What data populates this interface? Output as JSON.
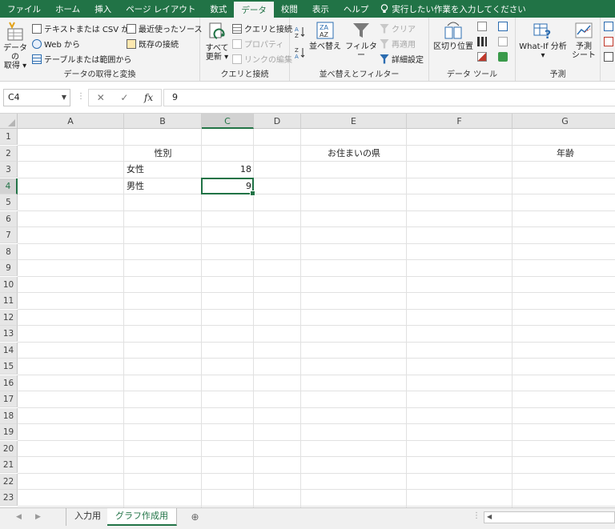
{
  "tabs": [
    "ファイル",
    "ホーム",
    "挿入",
    "ページ レイアウト",
    "数式",
    "データ",
    "校閲",
    "表示",
    "ヘルプ"
  ],
  "active_tab": "データ",
  "tell_me": "実行したい作業を入力してください",
  "ribbon": {
    "get_data": {
      "big_label_1": "データの",
      "big_label_2": "取得 ▾",
      "from_text_csv": "テキストまたは CSV から",
      "from_web": "Web から",
      "from_table": "テーブルまたは範囲から",
      "recent_sources": "最近使ったソース",
      "existing_connections": "既存の接続",
      "group_label": "データの取得と変換"
    },
    "queries": {
      "refresh_all_1": "すべて",
      "refresh_all_2": "更新 ▾",
      "queries_connections": "クエリと接続",
      "properties": "プロパティ",
      "edit_links": "リンクの編集",
      "group_label": "クエリと接続"
    },
    "sort_filter": {
      "sort": "並べ替え",
      "filter": "フィルター",
      "clear": "クリア",
      "reapply": "再適用",
      "advanced": "詳細設定",
      "group_label": "並べ替えとフィルター"
    },
    "data_tools": {
      "text_to_columns": "区切り位置",
      "group_label": "データ ツール"
    },
    "forecast": {
      "what_if": "What-If 分析",
      "what_if_dd": "▾",
      "forecast_sheet_1": "予測",
      "forecast_sheet_2": "シート",
      "group_label": "予測"
    }
  },
  "formula_bar": {
    "name_box": "C4",
    "cancel": "✕",
    "enter": "✓",
    "fx": "fx",
    "value": "9"
  },
  "columns": [
    "A",
    "B",
    "C",
    "D",
    "E",
    "F",
    "G"
  ],
  "rows": [
    "1",
    "2",
    "3",
    "4",
    "5",
    "6",
    "7",
    "8",
    "9",
    "10",
    "11",
    "12",
    "13",
    "14",
    "15",
    "16",
    "17",
    "18",
    "19",
    "20",
    "21",
    "22",
    "23"
  ],
  "cells": {
    "B2": "性別",
    "E2": "お住まいの県",
    "G2": "年齢",
    "B3": "女性",
    "C3": "18",
    "B4": "男性",
    "C4": "9"
  },
  "selected_cell": "C4",
  "sheets": [
    "入力用",
    "グラフ作成用"
  ],
  "active_sheet": "グラフ作成用",
  "add_sheet": "⊕",
  "colors": {
    "accent": "#217346"
  }
}
